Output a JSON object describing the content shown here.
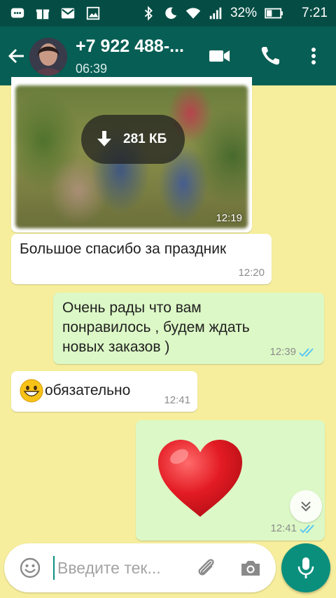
{
  "status_bar": {
    "battery": "32%",
    "time": "7:21"
  },
  "header": {
    "contact": "+7 922 488-...",
    "last_seen": "06:39"
  },
  "messages": [
    {
      "type": "image",
      "download_size": "281 КБ",
      "time": "12:19"
    },
    {
      "type": "text",
      "direction": "in",
      "text": "Большое спасибо за праздник",
      "time": "12:20"
    },
    {
      "type": "text",
      "direction": "out",
      "lines": [
        "Очень рады что вам",
        "понравилось , будем ждать",
        "новых заказов )"
      ],
      "time": "12:39",
      "status": "read"
    },
    {
      "type": "text",
      "direction": "in",
      "emoji": "grinning-face",
      "text": "обязательно",
      "time": "12:41"
    },
    {
      "type": "sticker",
      "direction": "out",
      "emoji": "red-heart",
      "time": "12:41",
      "status": "read"
    }
  ],
  "input": {
    "placeholder": "Введите тек..."
  },
  "colors": {
    "header": "#075e54",
    "status_bar": "#054d44",
    "chat_background": "#f6ee9c",
    "outgoing_bubble": "#dcf8c6",
    "incoming_bubble": "#ffffff",
    "read_ticks": "#4fc3f7",
    "accent": "#0a8f7d"
  }
}
